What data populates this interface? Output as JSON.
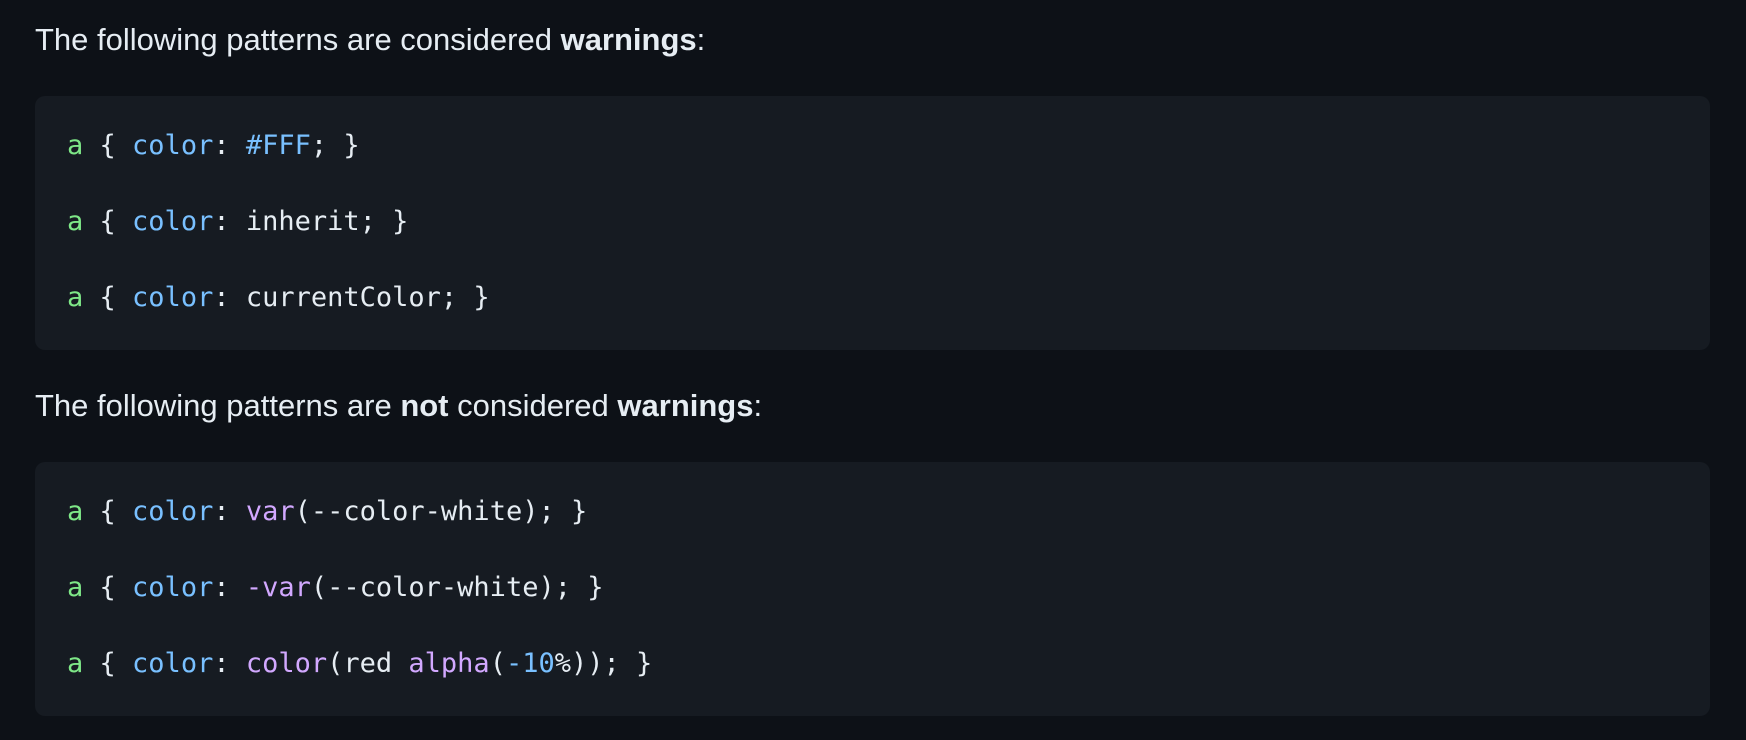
{
  "paragraph_1": {
    "prefix": "The following patterns are considered ",
    "bold": "warnings",
    "suffix": ":"
  },
  "block_1": {
    "lines": [
      {
        "selector": "a",
        "open": " { ",
        "property": "color",
        "colon": ": ",
        "value_const": "#FFF",
        "close": "; }"
      },
      {
        "selector": "a",
        "open": " { ",
        "property": "color",
        "colon": ": ",
        "value": "inherit",
        "close": "; }"
      },
      {
        "selector": "a",
        "open": " { ",
        "property": "color",
        "colon": ": ",
        "value": "currentColor",
        "close": "; }"
      }
    ]
  },
  "paragraph_2": {
    "prefix": "The following patterns are ",
    "bold_1": "not",
    "middle": " considered ",
    "bold_2": "warnings",
    "suffix": ":"
  },
  "block_2": {
    "lines": [
      {
        "selector": "a",
        "open": " { ",
        "property": "color",
        "colon": ": ",
        "fn": "var",
        "args": "(--color-white)",
        "close": "; }"
      },
      {
        "selector": "a",
        "open": " { ",
        "property": "color",
        "colon": ": ",
        "fn": "-var",
        "args": "(--color-white)",
        "close": "; }"
      },
      {
        "selector": "a",
        "open": " { ",
        "property": "color",
        "colon": ": ",
        "fn": "color",
        "args_open": "(red ",
        "fn_inner": "alpha",
        "paren_inner": "(",
        "number": "-10",
        "unit": "%",
        "args_close": "))",
        "close": "; }"
      }
    ]
  },
  "colors": {
    "background": "#0d1117",
    "code_background": "#161b22",
    "text": "#e6edf3",
    "selector": "#7ee787",
    "property": "#79c0ff",
    "function": "#d2a8ff"
  }
}
